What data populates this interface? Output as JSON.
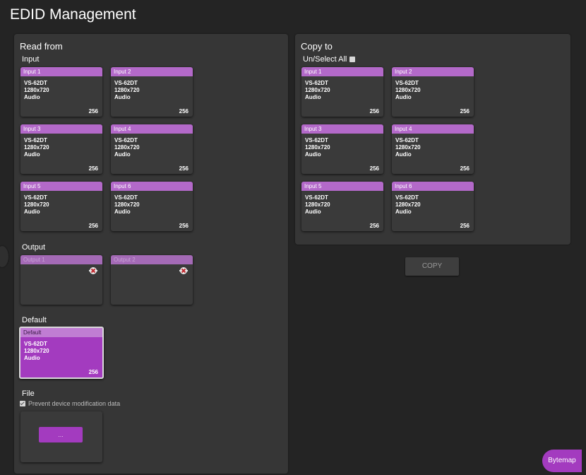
{
  "page": {
    "title": "EDID Management"
  },
  "read_from": {
    "title": "Read from",
    "input_label": "Input",
    "inputs": [
      {
        "name": "Input 1",
        "model": "VS-62DT",
        "resolution": "1280x720",
        "audio": "Audio",
        "size": "256"
      },
      {
        "name": "Input 2",
        "model": "VS-62DT",
        "resolution": "1280x720",
        "audio": "Audio",
        "size": "256"
      },
      {
        "name": "Input 3",
        "model": "VS-62DT",
        "resolution": "1280x720",
        "audio": "Audio",
        "size": "256"
      },
      {
        "name": "Input 4",
        "model": "VS-62DT",
        "resolution": "1280x720",
        "audio": "Audio",
        "size": "256"
      },
      {
        "name": "Input 5",
        "model": "VS-62DT",
        "resolution": "1280x720",
        "audio": "Audio",
        "size": "256"
      },
      {
        "name": "Input 6",
        "model": "VS-62DT",
        "resolution": "1280x720",
        "audio": "Audio",
        "size": "256"
      }
    ],
    "output_label": "Output",
    "outputs": [
      {
        "name": "Output 1",
        "icon": "disconnected-icon"
      },
      {
        "name": "Output 2",
        "icon": "disconnected-icon"
      }
    ],
    "default_label": "Default",
    "default": {
      "name": "Default",
      "model": "VS-62DT",
      "resolution": "1280x720",
      "audio": "Audio",
      "size": "256"
    },
    "file_label": "File",
    "prevent_label": "Prevent device modification data",
    "file_button": "..."
  },
  "copy_to": {
    "title": "Copy to",
    "select_all_label": "Un/Select All",
    "inputs": [
      {
        "name": "Input 1",
        "model": "VS-62DT",
        "resolution": "1280x720",
        "audio": "Audio",
        "size": "256"
      },
      {
        "name": "Input 2",
        "model": "VS-62DT",
        "resolution": "1280x720",
        "audio": "Audio",
        "size": "256"
      },
      {
        "name": "Input 3",
        "model": "VS-62DT",
        "resolution": "1280x720",
        "audio": "Audio",
        "size": "256"
      },
      {
        "name": "Input 4",
        "model": "VS-62DT",
        "resolution": "1280x720",
        "audio": "Audio",
        "size": "256"
      },
      {
        "name": "Input 5",
        "model": "VS-62DT",
        "resolution": "1280x720",
        "audio": "Audio",
        "size": "256"
      },
      {
        "name": "Input 6",
        "model": "VS-62DT",
        "resolution": "1280x720",
        "audio": "Audio",
        "size": "256"
      }
    ],
    "copy_button": "COPY"
  },
  "bytemap_button": "Bytemap",
  "colors": {
    "accent": "#a33bbf",
    "header": "#b369c9",
    "panel": "#363636",
    "background": "#242424"
  }
}
